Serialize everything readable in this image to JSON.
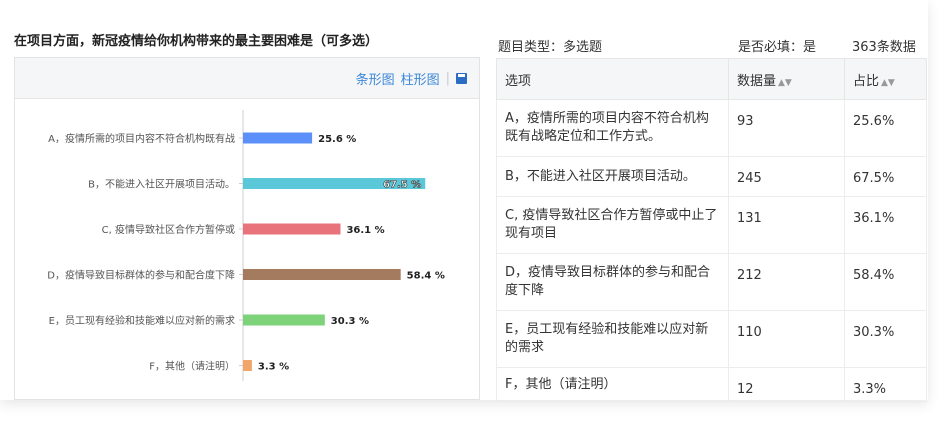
{
  "question_title": "在项目方面，新冠疫情给你机构带来的最主要困难是（可多选）",
  "view_links": {
    "bar": "条形图",
    "column": "柱形图",
    "save_icon": "save-icon"
  },
  "meta": {
    "type_label": "题目类型：多选题",
    "required_label": "是否必填：是",
    "count_label": "363条数据"
  },
  "table": {
    "headers": [
      "选项",
      "数据量",
      "占比"
    ],
    "sort_icon": "sort-icon",
    "rows": [
      {
        "option": "A，疫情所需的项目内容不符合机构既有战略定位和工作方式。",
        "count": "93",
        "pct": "25.6%"
      },
      {
        "option": "B，不能进入社区开展项目活动。",
        "count": "245",
        "pct": "67.5%"
      },
      {
        "option": "C, 疫情导致社区合作方暂停或中止了现有项目",
        "count": "131",
        "pct": "36.1%"
      },
      {
        "option": "D，疫情导致目标群体的参与和配合度下降",
        "count": "212",
        "pct": "58.4%"
      },
      {
        "option": "E，员工现有经验和技能难以应对新的需求",
        "count": "110",
        "pct": "30.3%"
      },
      {
        "option": "F，其他（请注明）",
        "count": "12",
        "pct": "3.3%"
      }
    ]
  },
  "chart_data": {
    "type": "bar",
    "orientation": "horizontal",
    "categories": [
      "A，疫情所需的项目内容不符合机构既有战",
      "B，不能进入社区开展项目活动。",
      "C, 疫情导致社区合作方暂停或",
      "D，疫情导致目标群体的参与和配合度下降",
      "E，员工现有经验和技能难以应对新的需求",
      "F，其他（请注明）"
    ],
    "values": [
      25.6,
      67.5,
      36.1,
      58.4,
      30.3,
      3.3
    ],
    "value_labels": [
      "25.6 %",
      "67.5 %",
      "36.1 %",
      "58.4 %",
      "30.3 %",
      "3.3 %"
    ],
    "colors": [
      "#5b8ff9",
      "#5ac8d8",
      "#e8737a",
      "#a47b5f",
      "#7ed37a",
      "#f3a66b"
    ],
    "xlim": [
      0,
      100
    ],
    "grid": false,
    "legend": "none"
  }
}
